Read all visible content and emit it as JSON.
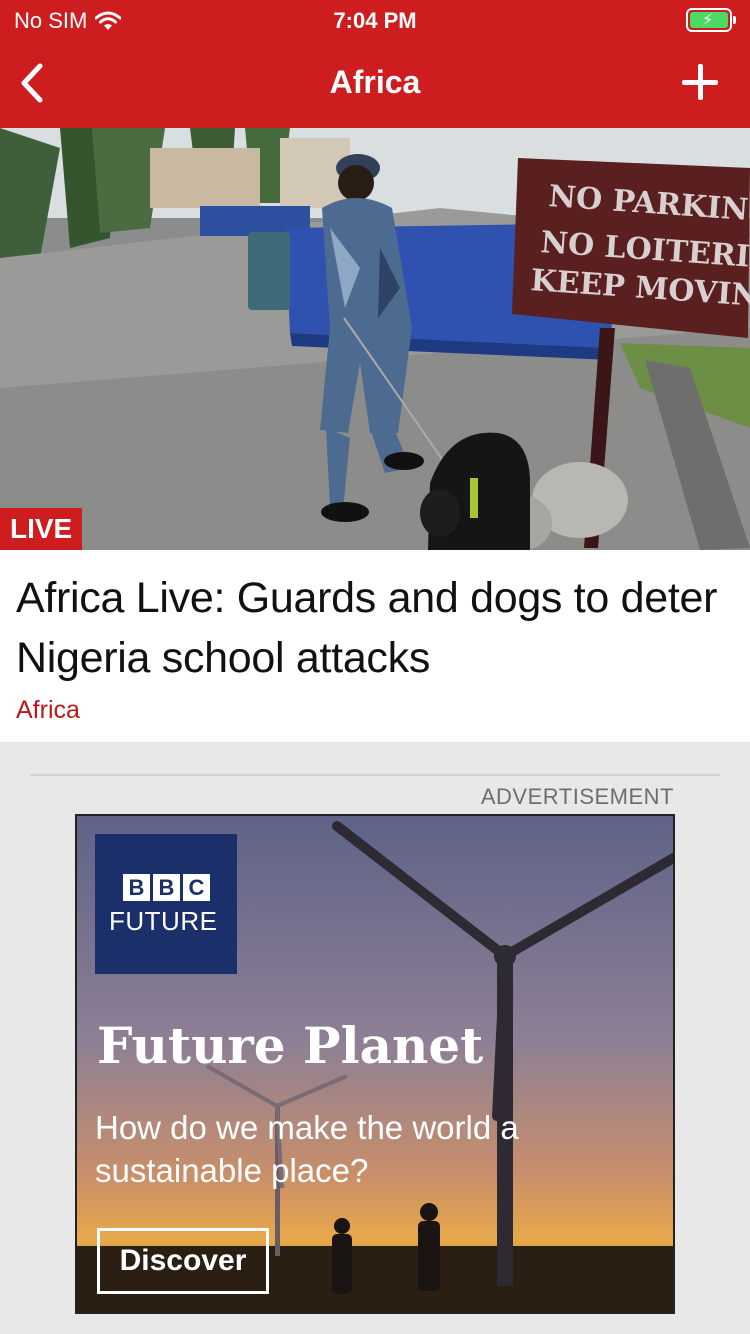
{
  "status_bar": {
    "carrier": "No SIM",
    "time": "7:04 PM"
  },
  "nav": {
    "title": "Africa"
  },
  "hero": {
    "sign_lines": [
      "NO PARKING",
      "NO LOITERING",
      "KEEP MOVING"
    ],
    "live_label": "LIVE"
  },
  "story": {
    "headline": "Africa Live: Guards and dogs to deter Nigeria school attacks",
    "topic": "Africa"
  },
  "advert": {
    "label": "ADVERTISEMENT",
    "logo_letters": [
      "B",
      "B",
      "C"
    ],
    "logo_sub": "FUTURE",
    "title": "Future Planet",
    "subtitle": "How do we make the world a sustainable place?",
    "cta": "Discover"
  },
  "colors": {
    "brand_red": "#cd1d1f",
    "topic_red": "#bb1919",
    "bbc_blue": "#1b2f6b"
  }
}
